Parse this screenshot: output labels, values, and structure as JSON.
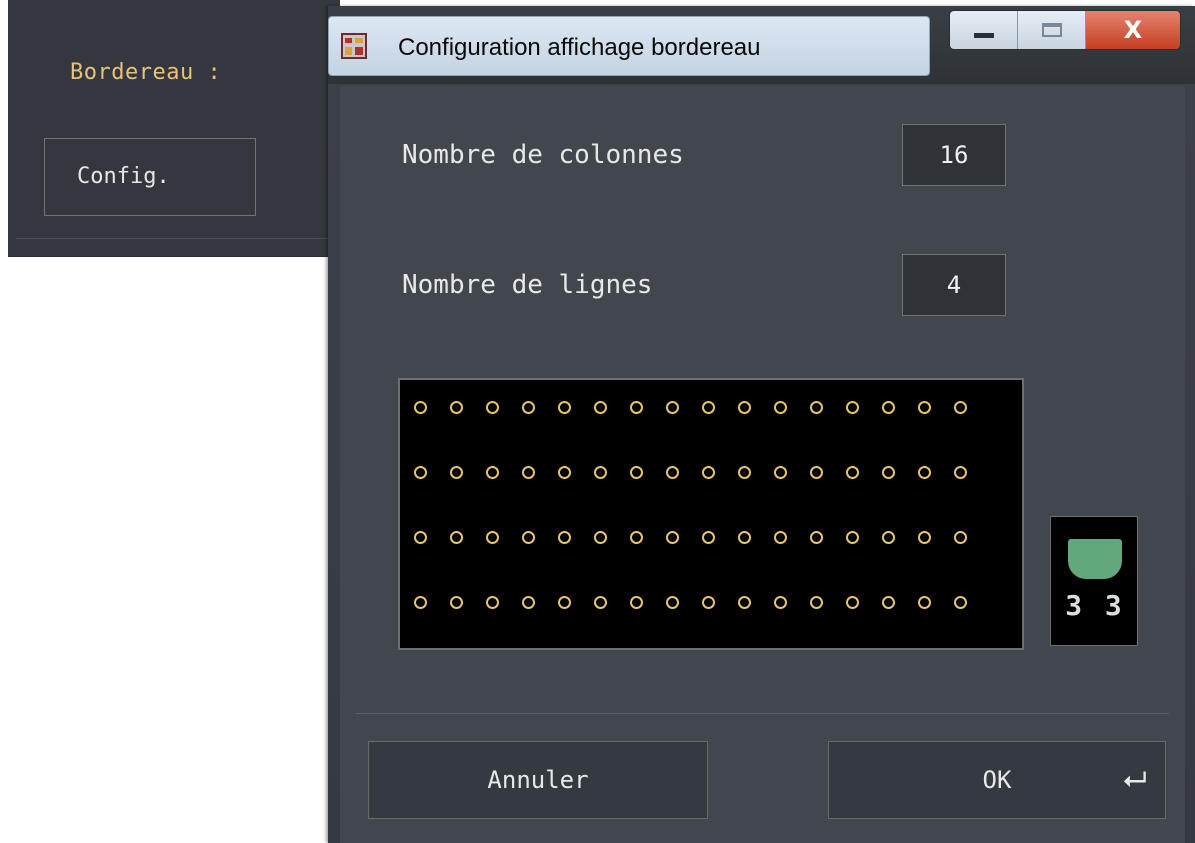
{
  "background_panel": {
    "label": "Bordereau :",
    "config_button": "Config."
  },
  "dialog": {
    "title": "Configuration affichage bordereau",
    "window_buttons": {
      "close": "X"
    },
    "columns": {
      "label": "Nombre de colonnes",
      "value": "16"
    },
    "rows": {
      "label": "Nombre de lignes",
      "value": "4"
    },
    "preview": {
      "dot_color": "#e7c46f",
      "rows": 4,
      "columns": 16
    },
    "mini_preview": {
      "count": "3 3",
      "cup_color": "#63a77c"
    },
    "cancel_button": "Annuler",
    "ok_button": "OK",
    "ok_icon": "enter-key-icon"
  }
}
